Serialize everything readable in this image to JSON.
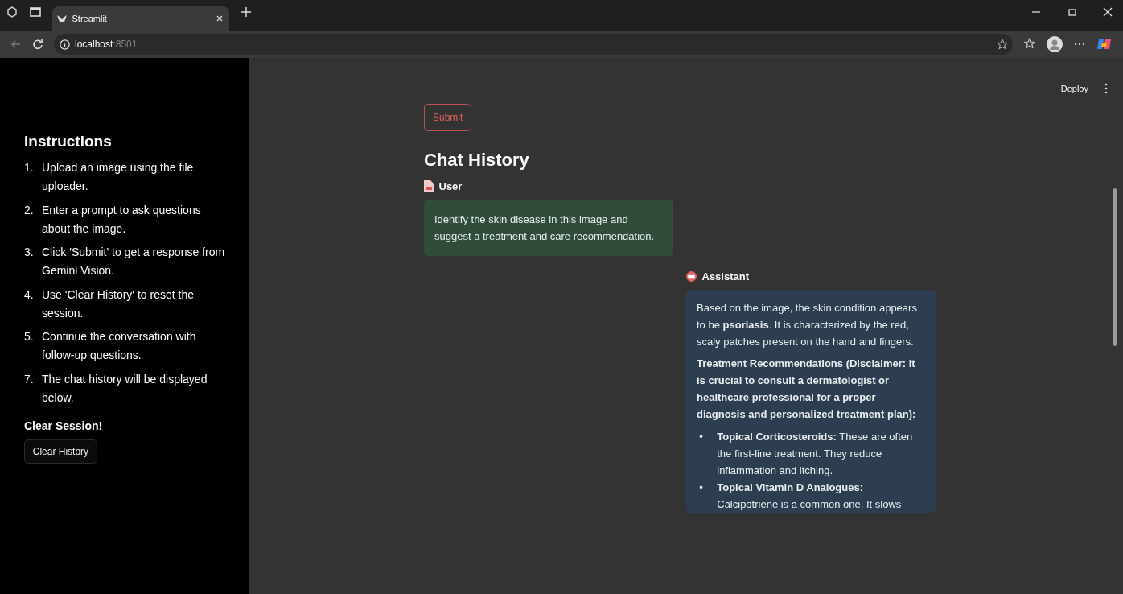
{
  "browser": {
    "tab_title": "Streamlit",
    "address_host": "localhost",
    "address_port": ":8501"
  },
  "header": {
    "deploy": "Deploy"
  },
  "sidebar": {
    "title": "Instructions",
    "steps": [
      {
        "number": "1.",
        "text": "Upload an image using the file uploader."
      },
      {
        "number": "2.",
        "text": "Enter a prompt to ask questions about the image."
      },
      {
        "number": "3.",
        "text": "Click 'Submit' to get a response from Gemini Vision."
      },
      {
        "number": "4.",
        "text": "Use 'Clear History' to reset the session."
      },
      {
        "number": "5.",
        "text": "Continue the conversation with follow-up questions."
      },
      {
        "number": "7.",
        "text": "The chat history will be displayed below."
      }
    ],
    "section_title": "Clear Session!",
    "clear_button": "Clear History"
  },
  "main": {
    "submit_button": "Submit",
    "heading": "Chat History",
    "messages": [
      {
        "kind": "user",
        "name": "User",
        "blocks": [
          {
            "kind": "paragraph",
            "text": "Identify the skin disease in this image and suggest a treatment and care recommendation."
          }
        ]
      },
      {
        "kind": "assistant",
        "name": "Assistant",
        "blocks": [
          {
            "kind": "paragraph",
            "text": "Based on the image, the skin condition appears to be **psoriasis**. It is characterized by the red, scaly patches present on the hand and fingers."
          },
          {
            "kind": "bold_paragraph",
            "text": "Treatment Recommendations (Disclaimer: It is crucial to consult a dermatologist or healthcare professional for a proper diagnosis and personalized treatment plan):"
          },
          {
            "kind": "bullets",
            "items": [
              {
                "marker": "•",
                "text": "**Topical Corticosteroids:** These are often the first-line treatment. They reduce inflammation and itching."
              },
              {
                "marker": "•",
                "text": "**Topical Vitamin D Analogues:** Calcipotriene is a common one. It slows"
              }
            ]
          }
        ]
      }
    ]
  }
}
